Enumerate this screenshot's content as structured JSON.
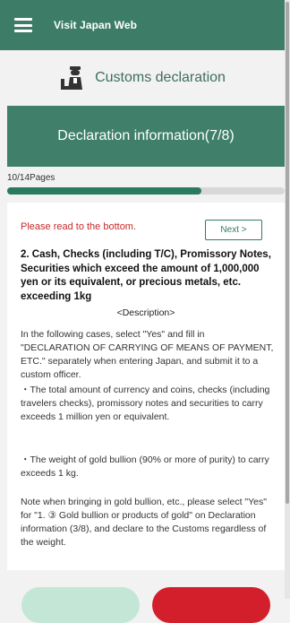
{
  "header": {
    "title": "Visit Japan Web"
  },
  "section": {
    "title": "Customs declaration",
    "band": "Declaration information(7/8)"
  },
  "progress": {
    "label": "10/14Pages",
    "value": 0.7,
    "color": "#2b7a5f"
  },
  "content": {
    "read_note": "Please read to the bottom.",
    "next_label": "Next >",
    "heading": "2. Cash, Checks (including T/C), Promissory Notes, Securities which exceed the amount of 1,000,000 yen or its equivalent, or precious metals, etc. exceeding 1kg",
    "description_title": "<Description>",
    "paragraphs": [
      "In the following cases, select \"Yes\" and fill in \"DECLARATION OF CARRYING OF MEANS OF PAYMENT, ETC.\" separately when entering Japan, and submit it to a custom officer.",
      "・The total amount of currency and coins, checks (including travelers checks), promissory notes and securities to carry exceeds 1 million yen or equivalent.",
      "・The weight of gold bullion (90% or more of purity) to carry exceeds 1 kg.",
      "Note when bringing in gold bullion, etc., please select \"Yes\" for \"1. ③ Gold bullion or products of gold\" on Declaration information (3/8), and declare to the Customs regardless of the weight."
    ]
  },
  "colors": {
    "brand_green": "#3d7d68",
    "band_green": "#40806a",
    "alert_red": "#c62828",
    "button_red": "#d21f2b",
    "button_mint": "#c4e6d7"
  }
}
